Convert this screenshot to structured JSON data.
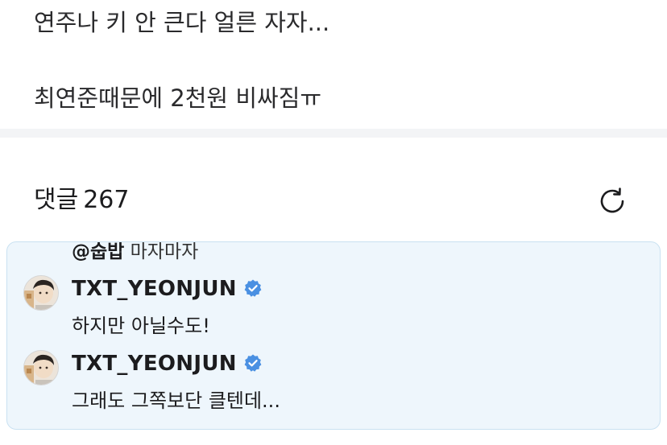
{
  "post": {
    "line1": "연주나 키 안 큰다 얼른 자자...",
    "line2": "최연준때문에 2천원 비싸짐ㅠ"
  },
  "comments": {
    "title": "댓글",
    "count": "267"
  },
  "thread": {
    "quote_mention": "@숩밥",
    "quote_text": "마자마자",
    "replies": [
      {
        "author": "TXT_YEONJUN",
        "verified_icon": "verified-badge-icon",
        "text": "하지만 아닐수도!"
      },
      {
        "author": "TXT_YEONJUN",
        "verified_icon": "verified-badge-icon",
        "text": "그래도 그쪽보단 클텐데..."
      }
    ]
  },
  "colors": {
    "thread_background": "#eef6fc",
    "thread_border": "#c9e1f1",
    "verified_blue": "#4a90e2",
    "divider": "#f3f4f6"
  },
  "icons": {
    "refresh": "refresh-icon"
  }
}
